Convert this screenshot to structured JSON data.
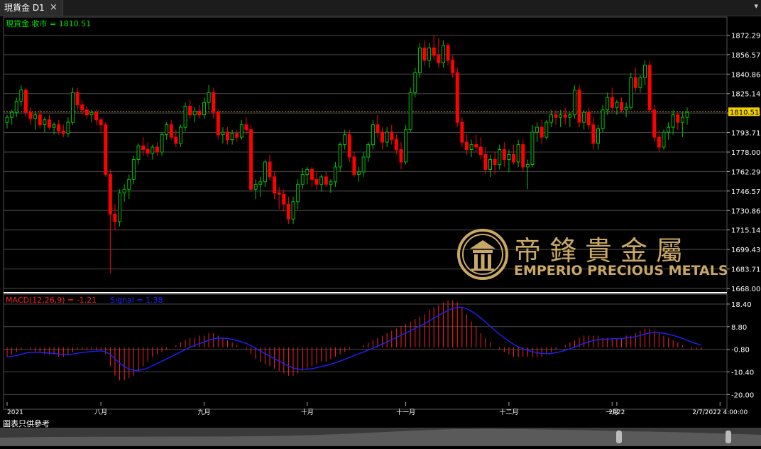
{
  "window": {
    "tab_title": "現貨金 D1",
    "close_glyph": "×",
    "corner_glyph": "▾"
  },
  "footer_note": "圖表只供參考",
  "logo": {
    "name_cn": "帝鋒貴金屬",
    "name_en": "EMPERIO PRECIOUS METALS"
  },
  "colors": {
    "up": "#00c000",
    "down": "#ff0000",
    "grid": "#4a4a4a",
    "price_line": "#d4a017",
    "signal": "#2020ff",
    "macd": "#ff2020",
    "label_green": "#00e000",
    "gold": "#c9a865"
  },
  "chart_data": {
    "type": "candlestick",
    "price_panel": {
      "legend": "現貨金.收市 = 1810.51",
      "current_price": 1810.51,
      "current_price_label": "1810.51",
      "ylim": [
        1668.0,
        1880.0
      ],
      "y_ticks": [
        1872.29,
        1856.57,
        1840.86,
        1825.14,
        1809.43,
        1793.71,
        1778.0,
        1762.29,
        1746.57,
        1730.86,
        1715.14,
        1699.43,
        1683.71,
        1668.0
      ],
      "y_tick_labels": [
        "1872.29",
        "1856.57",
        "1840.86",
        "1825.14",
        "1809.43",
        "1793.71",
        "1778.00",
        "1762.29",
        "1746.57",
        "1730.86",
        "1715.14",
        "1699.43",
        "1683.71",
        "1668.00"
      ]
    },
    "macd_panel": {
      "legend_macd": "MACD(12,26,9) = -1.21",
      "legend_signal": "Signal = 1.38",
      "ylim": [
        -22,
        22
      ],
      "y_ticks": [
        18.4,
        8.8,
        -0.8,
        -10.4,
        -20.0
      ],
      "y_tick_labels": [
        "18.40",
        "8.80",
        "-0.80",
        "-10.40",
        "-20.00"
      ]
    },
    "x_labels": [
      {
        "index": 0,
        "text": "2021"
      },
      {
        "index": 20,
        "text": "八月"
      },
      {
        "index": 42,
        "text": "九月"
      },
      {
        "index": 64,
        "text": "十月"
      },
      {
        "index": 85,
        "text": "十一月"
      },
      {
        "index": 107,
        "text": "十二月"
      },
      {
        "index": 129,
        "text": "一月"
      },
      {
        "index": 130,
        "text": "2022"
      },
      {
        "index": 152,
        "text": "2/7/2022 4:00:00"
      }
    ],
    "candles": [
      [
        1802,
        1808,
        1797,
        1806
      ],
      [
        1806,
        1812,
        1800,
        1810
      ],
      [
        1810,
        1822,
        1806,
        1819
      ],
      [
        1819,
        1832,
        1815,
        1828
      ],
      [
        1828,
        1830,
        1806,
        1810
      ],
      [
        1810,
        1814,
        1800,
        1805
      ],
      [
        1805,
        1810,
        1796,
        1808
      ],
      [
        1808,
        1812,
        1797,
        1800
      ],
      [
        1800,
        1806,
        1794,
        1804
      ],
      [
        1804,
        1808,
        1796,
        1798
      ],
      [
        1798,
        1802,
        1792,
        1800
      ],
      [
        1800,
        1804,
        1792,
        1795
      ],
      [
        1795,
        1800,
        1790,
        1793
      ],
      [
        1793,
        1806,
        1790,
        1802
      ],
      [
        1802,
        1830,
        1800,
        1826
      ],
      [
        1826,
        1830,
        1812,
        1816
      ],
      [
        1816,
        1820,
        1808,
        1812
      ],
      [
        1812,
        1815,
        1805,
        1808
      ],
      [
        1808,
        1812,
        1802,
        1810
      ],
      [
        1810,
        1812,
        1800,
        1804
      ],
      [
        1804,
        1806,
        1794,
        1800
      ],
      [
        1800,
        1802,
        1758,
        1760
      ],
      [
        1760,
        1764,
        1680,
        1728
      ],
      [
        1728,
        1736,
        1715,
        1722
      ],
      [
        1722,
        1748,
        1718,
        1745
      ],
      [
        1745,
        1752,
        1738,
        1748
      ],
      [
        1748,
        1760,
        1740,
        1756
      ],
      [
        1756,
        1775,
        1752,
        1772
      ],
      [
        1772,
        1785,
        1768,
        1783
      ],
      [
        1783,
        1790,
        1775,
        1780
      ],
      [
        1780,
        1786,
        1774,
        1777
      ],
      [
        1777,
        1784,
        1772,
        1782
      ],
      [
        1782,
        1786,
        1775,
        1778
      ],
      [
        1778,
        1794,
        1775,
        1792
      ],
      [
        1792,
        1802,
        1788,
        1800
      ],
      [
        1800,
        1804,
        1788,
        1790
      ],
      [
        1790,
        1796,
        1782,
        1785
      ],
      [
        1785,
        1800,
        1782,
        1798
      ],
      [
        1798,
        1818,
        1795,
        1815
      ],
      [
        1815,
        1820,
        1805,
        1808
      ],
      [
        1808,
        1814,
        1802,
        1811
      ],
      [
        1811,
        1816,
        1805,
        1808
      ],
      [
        1808,
        1822,
        1805,
        1818
      ],
      [
        1818,
        1832,
        1812,
        1826
      ],
      [
        1826,
        1830,
        1805,
        1810
      ],
      [
        1810,
        1812,
        1788,
        1792
      ],
      [
        1792,
        1798,
        1785,
        1794
      ],
      [
        1794,
        1798,
        1784,
        1788
      ],
      [
        1788,
        1796,
        1784,
        1793
      ],
      [
        1793,
        1796,
        1786,
        1790
      ],
      [
        1790,
        1804,
        1788,
        1800
      ],
      [
        1800,
        1806,
        1792,
        1796
      ],
      [
        1796,
        1800,
        1746,
        1748
      ],
      [
        1748,
        1756,
        1740,
        1752
      ],
      [
        1752,
        1758,
        1742,
        1754
      ],
      [
        1754,
        1772,
        1750,
        1770
      ],
      [
        1770,
        1776,
        1755,
        1758
      ],
      [
        1758,
        1762,
        1740,
        1745
      ],
      [
        1745,
        1750,
        1732,
        1744
      ],
      [
        1744,
        1748,
        1730,
        1736
      ],
      [
        1736,
        1742,
        1720,
        1724
      ],
      [
        1724,
        1742,
        1720,
        1738
      ],
      [
        1738,
        1756,
        1732,
        1752
      ],
      [
        1752,
        1765,
        1748,
        1760
      ],
      [
        1760,
        1766,
        1752,
        1764
      ],
      [
        1764,
        1766,
        1750,
        1756
      ],
      [
        1756,
        1762,
        1748,
        1752
      ],
      [
        1752,
        1760,
        1746,
        1758
      ],
      [
        1758,
        1762,
        1750,
        1752
      ],
      [
        1752,
        1756,
        1745,
        1754
      ],
      [
        1754,
        1770,
        1750,
        1766
      ],
      [
        1766,
        1786,
        1762,
        1784
      ],
      [
        1784,
        1796,
        1780,
        1792
      ],
      [
        1792,
        1796,
        1770,
        1774
      ],
      [
        1774,
        1778,
        1758,
        1760
      ],
      [
        1760,
        1766,
        1754,
        1762
      ],
      [
        1762,
        1778,
        1758,
        1774
      ],
      [
        1774,
        1786,
        1770,
        1784
      ],
      [
        1784,
        1804,
        1780,
        1800
      ],
      [
        1800,
        1808,
        1790,
        1794
      ],
      [
        1794,
        1798,
        1780,
        1786
      ],
      [
        1786,
        1798,
        1782,
        1794
      ],
      [
        1794,
        1800,
        1784,
        1788
      ],
      [
        1788,
        1792,
        1776,
        1780
      ],
      [
        1780,
        1786,
        1764,
        1770
      ],
      [
        1770,
        1800,
        1768,
        1796
      ],
      [
        1796,
        1830,
        1794,
        1826
      ],
      [
        1826,
        1846,
        1822,
        1842
      ],
      [
        1842,
        1866,
        1838,
        1862
      ],
      [
        1862,
        1868,
        1848,
        1852
      ],
      [
        1852,
        1866,
        1846,
        1862
      ],
      [
        1862,
        1872,
        1852,
        1856
      ],
      [
        1856,
        1870,
        1846,
        1850
      ],
      [
        1850,
        1868,
        1846,
        1864
      ],
      [
        1864,
        1866,
        1848,
        1852
      ],
      [
        1852,
        1856,
        1838,
        1842
      ],
      [
        1842,
        1846,
        1798,
        1802
      ],
      [
        1802,
        1806,
        1782,
        1786
      ],
      [
        1786,
        1792,
        1776,
        1780
      ],
      [
        1780,
        1788,
        1774,
        1784
      ],
      [
        1784,
        1792,
        1778,
        1782
      ],
      [
        1782,
        1790,
        1772,
        1776
      ],
      [
        1776,
        1782,
        1760,
        1764
      ],
      [
        1764,
        1776,
        1758,
        1772
      ],
      [
        1772,
        1778,
        1760,
        1768
      ],
      [
        1768,
        1784,
        1764,
        1780
      ],
      [
        1780,
        1786,
        1766,
        1772
      ],
      [
        1772,
        1780,
        1762,
        1776
      ],
      [
        1776,
        1784,
        1768,
        1770
      ],
      [
        1770,
        1788,
        1766,
        1784
      ],
      [
        1784,
        1788,
        1762,
        1766
      ],
      [
        1766,
        1772,
        1748,
        1768
      ],
      [
        1768,
        1800,
        1766,
        1794
      ],
      [
        1794,
        1802,
        1786,
        1798
      ],
      [
        1798,
        1804,
        1784,
        1790
      ],
      [
        1790,
        1804,
        1788,
        1802
      ],
      [
        1802,
        1812,
        1798,
        1808
      ],
      [
        1808,
        1812,
        1800,
        1806
      ],
      [
        1806,
        1812,
        1798,
        1808
      ],
      [
        1808,
        1814,
        1800,
        1806
      ],
      [
        1806,
        1810,
        1798,
        1808
      ],
      [
        1808,
        1832,
        1805,
        1828
      ],
      [
        1828,
        1832,
        1798,
        1802
      ],
      [
        1802,
        1812,
        1796,
        1810
      ],
      [
        1810,
        1814,
        1796,
        1800
      ],
      [
        1800,
        1806,
        1780,
        1785
      ],
      [
        1785,
        1800,
        1780,
        1797
      ],
      [
        1797,
        1816,
        1794,
        1812
      ],
      [
        1812,
        1826,
        1808,
        1822
      ],
      [
        1822,
        1830,
        1810,
        1814
      ],
      [
        1814,
        1820,
        1808,
        1818
      ],
      [
        1818,
        1822,
        1810,
        1812
      ],
      [
        1812,
        1818,
        1806,
        1814
      ],
      [
        1814,
        1842,
        1812,
        1838
      ],
      [
        1838,
        1846,
        1826,
        1830
      ],
      [
        1830,
        1840,
        1826,
        1838
      ],
      [
        1838,
        1852,
        1832,
        1848
      ],
      [
        1848,
        1852,
        1810,
        1812
      ],
      [
        1812,
        1816,
        1786,
        1790
      ],
      [
        1790,
        1796,
        1778,
        1782
      ],
      [
        1782,
        1796,
        1780,
        1794
      ],
      [
        1794,
        1802,
        1788,
        1798
      ],
      [
        1798,
        1812,
        1792,
        1808
      ],
      [
        1808,
        1810,
        1796,
        1802
      ],
      [
        1802,
        1810,
        1790,
        1806
      ],
      [
        1806,
        1814,
        1800,
        1810
      ]
    ],
    "macd": [
      -4,
      -3,
      -2,
      -1,
      0,
      -1,
      -2,
      -2,
      -3,
      -3,
      -3,
      -4,
      -4,
      -3,
      -2,
      -1,
      -1,
      -1,
      -1,
      -1,
      -1,
      -3,
      -8,
      -12,
      -14,
      -14,
      -13,
      -12,
      -10,
      -8,
      -6,
      -4,
      -3,
      -2,
      -1,
      0,
      1,
      2,
      3,
      4,
      4,
      5,
      5,
      6,
      6,
      5,
      4,
      3,
      2,
      1,
      0,
      -1,
      -3,
      -5,
      -6,
      -7,
      -8,
      -9,
      -10,
      -11,
      -12,
      -12,
      -11,
      -10,
      -9,
      -8,
      -7,
      -6,
      -6,
      -5,
      -4,
      -3,
      -2,
      -1,
      0,
      0,
      1,
      2,
      3,
      4,
      5,
      6,
      7,
      8,
      9,
      10,
      11,
      12,
      13,
      14,
      16,
      17,
      18,
      19,
      20,
      20,
      19,
      17,
      14,
      11,
      9,
      6,
      4,
      2,
      0,
      -1,
      -2,
      -3,
      -4,
      -4,
      -4,
      -4,
      -4,
      -4,
      -4,
      -3,
      -2,
      -1,
      0,
      1,
      2,
      3,
      4,
      5,
      5,
      5,
      5,
      4,
      4,
      4,
      4,
      4,
      5,
      5,
      6,
      7,
      8,
      8,
      7,
      6,
      5,
      4,
      3,
      2,
      1,
      0,
      -1,
      -1,
      -1
    ]
  }
}
